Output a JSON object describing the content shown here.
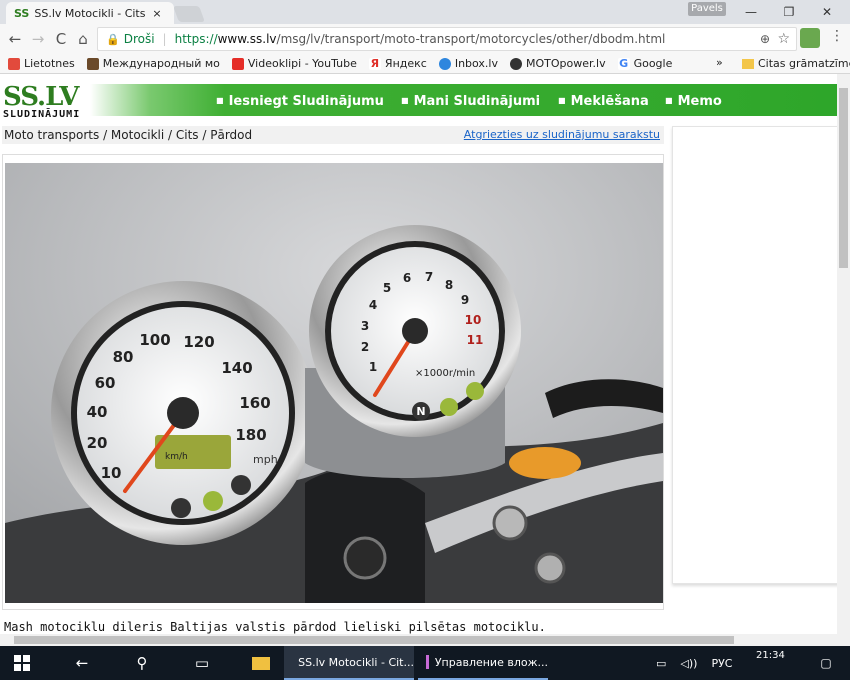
{
  "browser": {
    "tab_favicon": "SS",
    "tab_title": "SS.lv Motocikli - Cits, Ce",
    "tab_close": "×",
    "profile": "Pavels",
    "win_min": "—",
    "win_restore": "❐",
    "win_close": "✕",
    "back": "←",
    "forward": "→",
    "reload": "C",
    "home": "⌂",
    "secure_label": "Droši",
    "url": "https://www.ss.lv/msg/lv/transport/moto-transport/motorcycles/other/dbodm.html",
    "url_prefix": "https://",
    "url_host": "www.ss.lv",
    "url_path": "/msg/lv/transport/moto-transport/motorcycles/other/dbodm.html",
    "menu": "⋮"
  },
  "bookmarks": {
    "items": [
      {
        "label": "Lietotnes",
        "color": "#e24a3c"
      },
      {
        "label": "Международный мо",
        "color": "#6b4a2a"
      },
      {
        "label": "Videoklipi - YouTube",
        "color": "#e52d27"
      },
      {
        "label": "Яндекс",
        "color": "#e0312b"
      },
      {
        "label": "Inbox.lv",
        "color": "#2e86de"
      },
      {
        "label": "MOTOpower.lv",
        "color": "#333333"
      },
      {
        "label": "Google",
        "color": "#4285f4"
      }
    ],
    "more": "»",
    "other": "Citas grāmatzīmes"
  },
  "site": {
    "logo_big": "SS.LV",
    "logo_small": "SLUDINĀJUMI",
    "menu": [
      "Iesniegt Sludinājumu",
      "Mani Sludinājumi",
      "Meklēšana",
      "Memo"
    ],
    "breadcrumb": "Moto transports / Motocikli / Cits / Pārdod",
    "back_link": "Atgriezties uz sludinājumu sarakstu",
    "description": "Mash motociklu dileris Baltijas valstis pārdod lieliski pilsētas motociklu.",
    "accent": "#2ea62a"
  },
  "gauges": {
    "speed_ticks": [
      "10",
      "20",
      "40",
      "60",
      "80",
      "100",
      "120",
      "140",
      "160",
      "180"
    ],
    "speed_unit": "mph",
    "kmh_unit": "km/h",
    "rpm_ticks": [
      "1",
      "2",
      "3",
      "4",
      "5",
      "6",
      "7",
      "8",
      "9",
      "10",
      "11"
    ],
    "rpm_unit": "×1000r/min",
    "neutral": "N"
  },
  "taskbar": {
    "chrome_app": "SS.lv Motocikli - Cit...",
    "other_app": "Управление влож...",
    "lang": "РУС",
    "time": "21:34"
  }
}
